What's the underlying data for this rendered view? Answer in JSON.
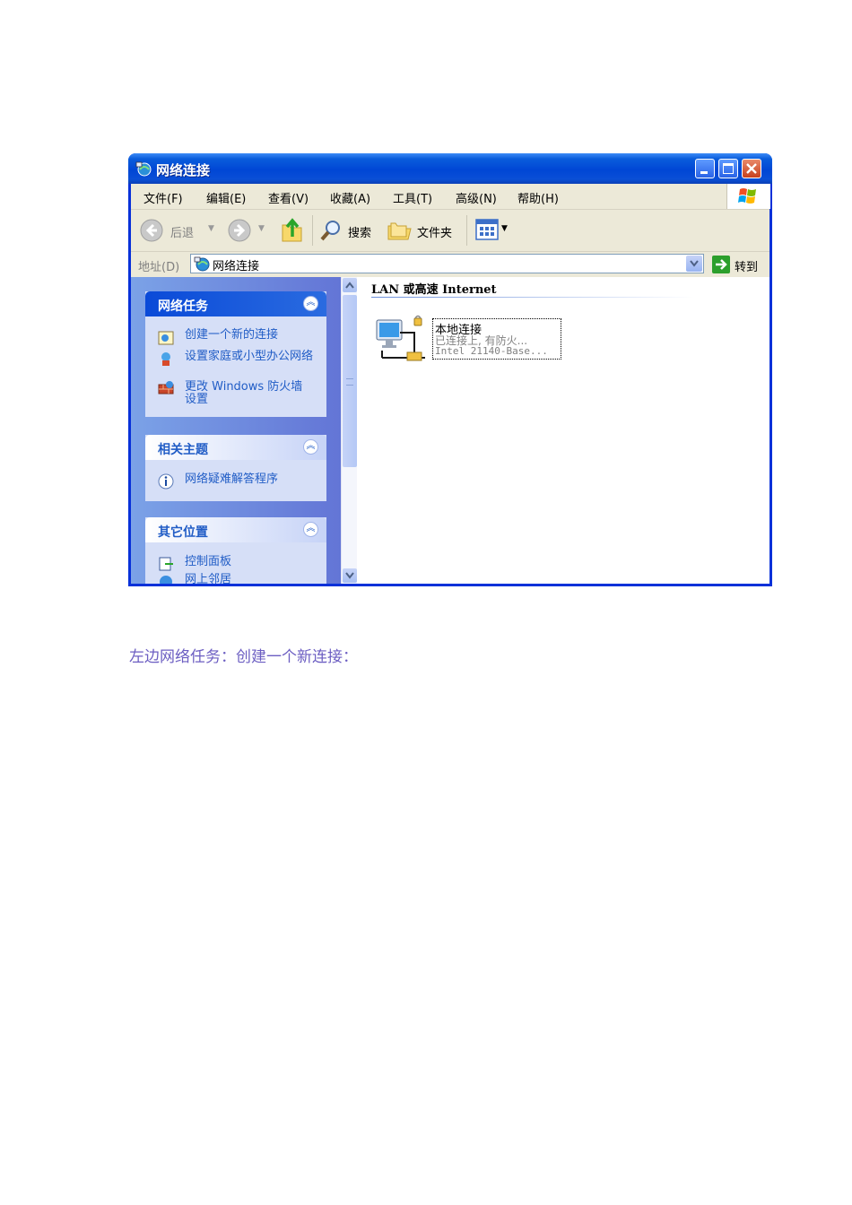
{
  "window": {
    "title": "网络连接",
    "menu": [
      "文件(F)",
      "编辑(E)",
      "查看(V)",
      "收藏(A)",
      "工具(T)",
      "高级(N)",
      "帮助(H)"
    ],
    "toolbar": {
      "back": "后退",
      "search": "搜索",
      "folders": "文件夹"
    },
    "address": {
      "label": "地址(D)",
      "value": "网络连接",
      "go": "转到"
    }
  },
  "sidebar": {
    "panels": [
      {
        "title": "网络任务",
        "items": [
          "创建一个新的连接",
          "设置家庭或小型办公网络",
          "更改 Windows 防火墙设置"
        ]
      },
      {
        "title": "相关主题",
        "items": [
          "网络疑难解答程序"
        ]
      },
      {
        "title": "其它位置",
        "items": [
          "控制面板",
          "网上邻居"
        ]
      }
    ]
  },
  "content": {
    "group_header": "LAN 或高速 Internet",
    "connection": {
      "name": "本地连接",
      "status": "已连接上, 有防火...",
      "device": "Intel 21140-Base..."
    }
  },
  "caption": "左边网络任务：创建一个新连接："
}
